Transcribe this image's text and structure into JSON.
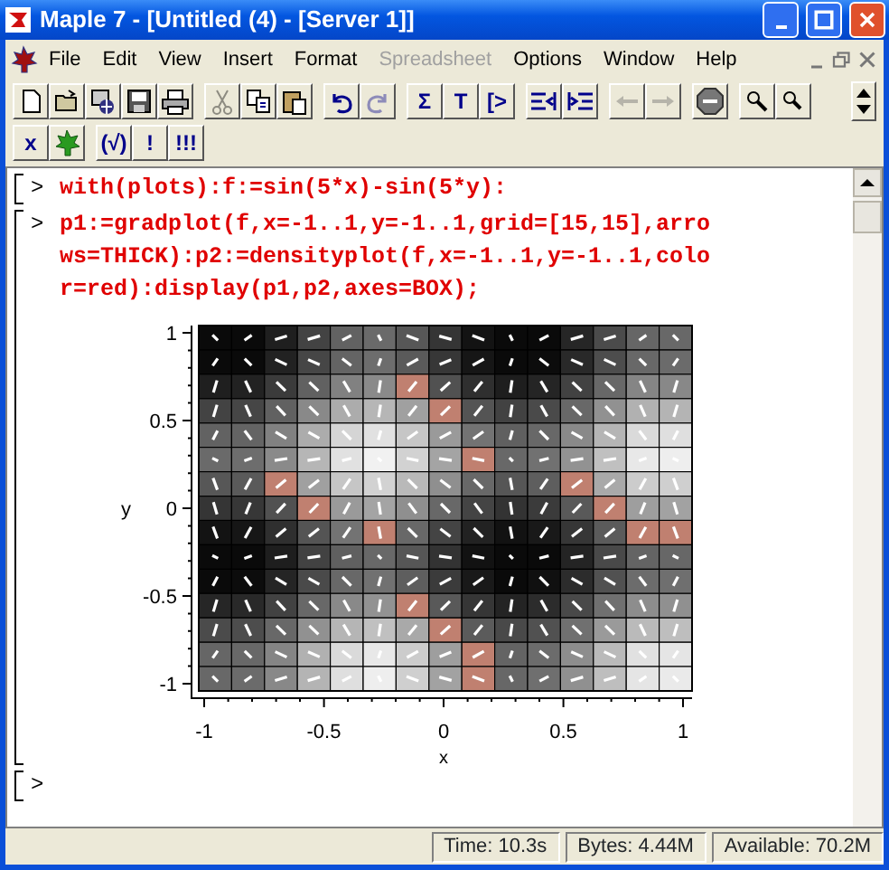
{
  "window": {
    "title": "Maple 7  - [Untitled (4) - [Server 1]]"
  },
  "menu": [
    {
      "label": "File",
      "disabled": false
    },
    {
      "label": "Edit",
      "disabled": false
    },
    {
      "label": "View",
      "disabled": false
    },
    {
      "label": "Insert",
      "disabled": false
    },
    {
      "label": "Format",
      "disabled": false
    },
    {
      "label": "Spreadsheet",
      "disabled": true
    },
    {
      "label": "Options",
      "disabled": false
    },
    {
      "label": "Window",
      "disabled": false
    },
    {
      "label": "Help",
      "disabled": false
    }
  ],
  "toolbar_1": [
    [
      {
        "kind": "icon",
        "disabled": false
      },
      {
        "kind": "icon",
        "disabled": false
      },
      {
        "kind": "icon",
        "disabled": false
      },
      {
        "kind": "icon",
        "disabled": false
      },
      {
        "kind": "icon",
        "disabled": false
      }
    ],
    [
      {
        "kind": "icon",
        "disabled": true
      },
      {
        "kind": "icon",
        "disabled": false
      },
      {
        "kind": "icon",
        "disabled": false
      }
    ],
    [
      {
        "kind": "icon",
        "disabled": false
      },
      {
        "kind": "icon",
        "disabled": true
      }
    ],
    [
      {
        "kind": "label",
        "label": "Σ",
        "disabled": false
      },
      {
        "kind": "label",
        "label": "T",
        "disabled": false
      },
      {
        "kind": "label",
        "label": "[>",
        "disabled": false
      }
    ],
    [
      {
        "kind": "icon",
        "disabled": false
      },
      {
        "kind": "icon",
        "disabled": false
      }
    ],
    [
      {
        "kind": "icon",
        "disabled": true
      },
      {
        "kind": "icon",
        "disabled": true
      }
    ],
    [
      {
        "kind": "icon",
        "disabled": false
      }
    ],
    [
      {
        "kind": "icon",
        "disabled": false
      },
      {
        "kind": "icon",
        "disabled": false
      }
    ]
  ],
  "toolbar_2": [
    [
      {
        "kind": "label",
        "label": "x",
        "disabled": false
      },
      {
        "kind": "icon",
        "disabled": false
      }
    ],
    [
      {
        "kind": "label",
        "label": "(√)",
        "disabled": false
      },
      {
        "kind": "label",
        "label": "!",
        "disabled": false
      },
      {
        "kind": "label",
        "label": "!!!",
        "disabled": false
      }
    ]
  ],
  "worksheet": {
    "groups": [
      {
        "prompt": ">",
        "lines": [
          "with(plots):f:=sin(5*x)-sin(5*y):"
        ]
      },
      {
        "prompt": ">",
        "lines": [
          "p1:=gradplot(f,x=-1..1,y=-1..1,grid=[15,15],arro",
          "ws=THICK):p2:=densityplot(f,x=-1..1,y=-1..1,colo",
          "r=red):display(p1,p2,axes=BOX);"
        ],
        "plot": {
          "xticks": [
            "-1",
            "-0.5",
            "0",
            "0.5",
            "1"
          ],
          "yticks": [
            "1",
            "0.5",
            "0",
            "-0.5",
            "-1"
          ],
          "xlabel": "x",
          "ylabel": "y"
        }
      },
      {
        "prompt": ">"
      }
    ]
  },
  "status_bar": [
    "Time: 10.3s",
    "Bytes: 4.44M",
    "Available: 70.2M"
  ]
}
